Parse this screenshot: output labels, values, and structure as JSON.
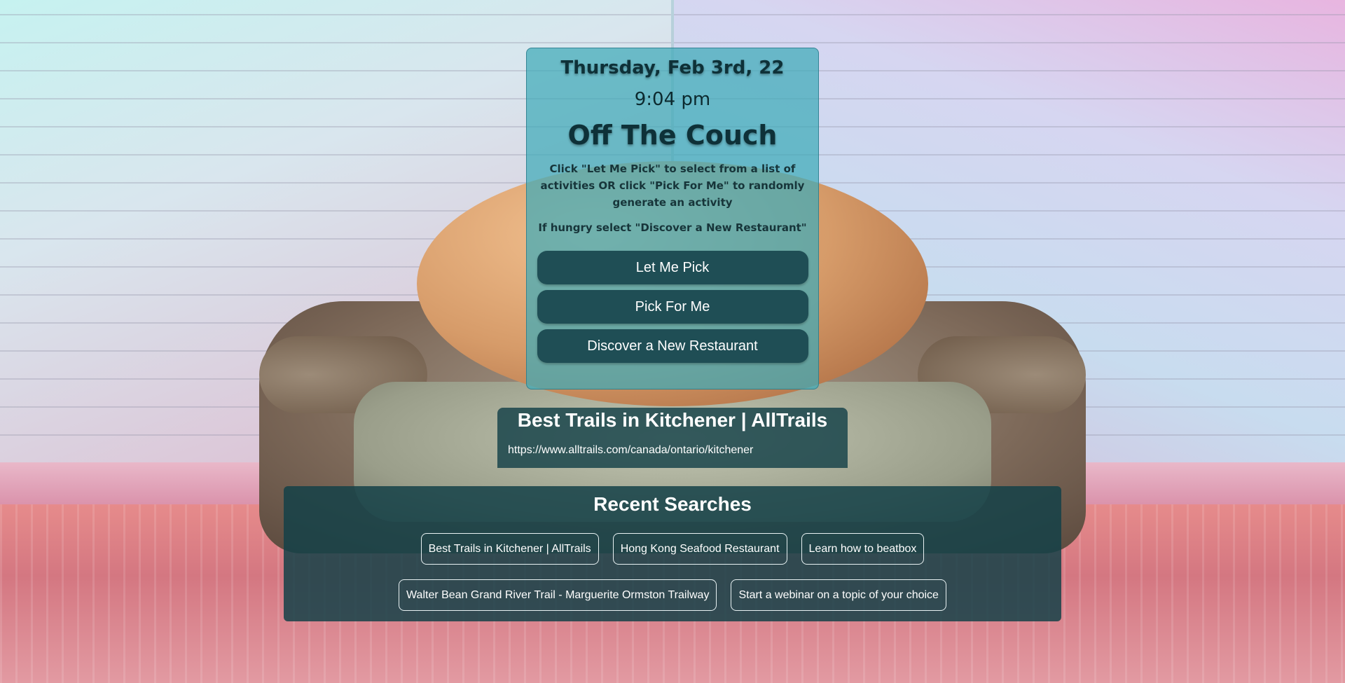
{
  "header": {
    "date": "Thursday, Feb 3rd, 22",
    "time": "9:04 pm",
    "app_title": "Off The Couch"
  },
  "instructions": {
    "main": "Click \"Let Me Pick\" to select from a list of activities OR click \"Pick For Me\" to randomly generate an activity",
    "hungry": "If hungry select \"Discover a New Restaurant\""
  },
  "buttons": {
    "let_me_pick": "Let Me Pick",
    "pick_for_me": "Pick For Me",
    "discover_restaurant": "Discover a New Restaurant"
  },
  "result": {
    "title": "Best Trails in Kitchener | AllTrails",
    "url": "https://www.alltrails.com/canada/ontario/kitchener"
  },
  "recent": {
    "title": "Recent Searches",
    "items": [
      "Best Trails in Kitchener | AllTrails",
      "Hong Kong Seafood Restaurant",
      "Learn how to beatbox",
      "Walter Bean Grand River Trail - Marguerite Ormston Trailway",
      "Start a webinar on a topic of your choice"
    ]
  },
  "colors": {
    "card_bg": "#3eaab9",
    "button_bg": "#1f4e55",
    "dark_panel": "#144148",
    "text_dark": "#0e3138"
  }
}
